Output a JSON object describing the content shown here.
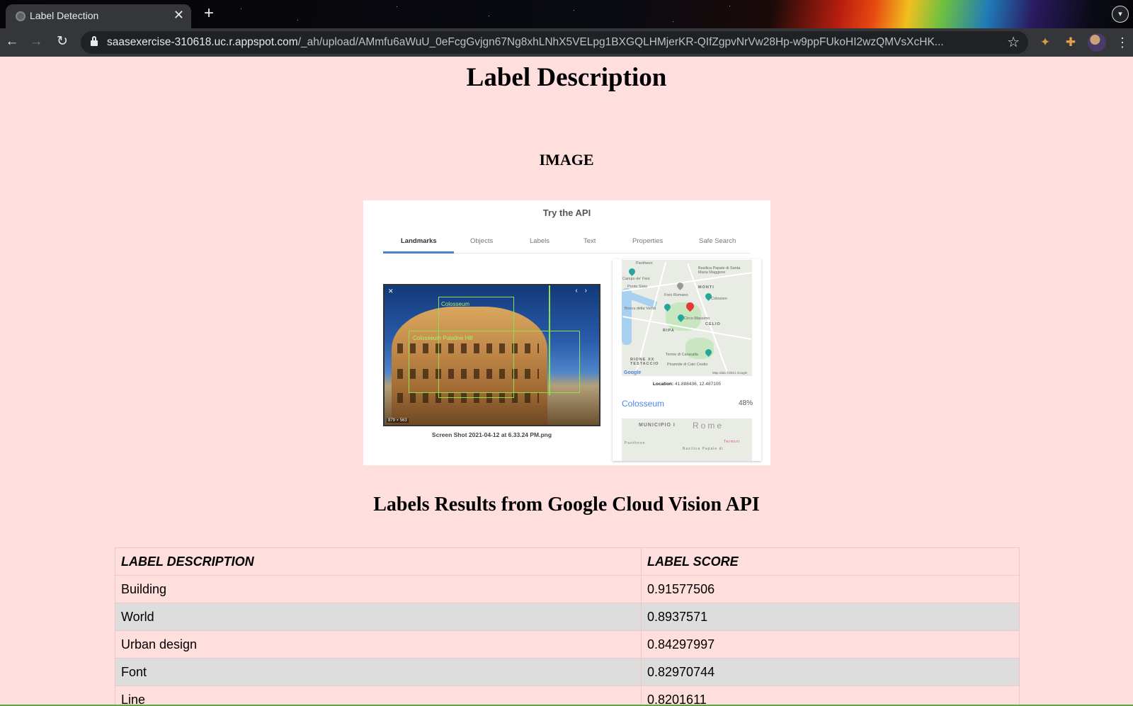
{
  "browser": {
    "tab_title": "Label Detection",
    "url_host": "saasexercise-310618.uc.r.appspot.com",
    "url_path": "/_ah/upload/AMmfu6aWuU_0eFcgGvjgn67Ng8xhLNhX5VELpg1BXGQLHMjerKR-QIfZgpvNrVw28Hp-w9ppFUkoHI2wzQMVsXcHK..."
  },
  "page": {
    "title": "Label Description",
    "image_heading": "IMAGE",
    "results_heading": "Labels Results from Google Cloud Vision API"
  },
  "screenshot": {
    "api_title": "Try the API",
    "tabs": [
      "Landmarks",
      "Objects",
      "Labels",
      "Text",
      "Properties",
      "Safe Search"
    ],
    "active_tab": "Landmarks",
    "bbox_labels": [
      "Colosseum",
      "Colosseum Palatine Hill"
    ],
    "image_dims": "879 × 563",
    "filename": "Screen Shot 2021-04-12 at 6.33.24 PM.png",
    "map_labels": [
      "Pantheon",
      "Basilica Papale di Santa Maria Maggiore",
      "Campo de' Fiori",
      "Ponte Sisto",
      "MONTI",
      "Foro Romano",
      "Colosseo",
      "Bocca della Verità",
      "Circo Massimo",
      "CELIO",
      "RIPA",
      "RIONE XX TESTACCIO",
      "Terme di Caracalla",
      "Piramide di Caio Cestio",
      "Map data ©2021 Google"
    ],
    "location_label": "Location:",
    "location_value": "41.888436, 12.487105",
    "landmark_name": "Colosseum",
    "landmark_score": "48%",
    "map2_labels": [
      "MUNICIPIO I",
      "Rome",
      "Pantheon",
      "Basilica Papale di",
      "Termini"
    ]
  },
  "table": {
    "headers": [
      "LABEL DESCRIPTION",
      "LABEL SCORE"
    ],
    "rows": [
      {
        "description": "Building",
        "score": "0.91577506"
      },
      {
        "description": "World",
        "score": "0.8937571"
      },
      {
        "description": "Urban design",
        "score": "0.84297997"
      },
      {
        "description": "Font",
        "score": "0.82970744"
      },
      {
        "description": "Line",
        "score": "0.8201611"
      }
    ]
  },
  "colors": {
    "page_background": "#ffdede",
    "striped_row": "#dddddd",
    "tab_accent": "#4a7fd6"
  }
}
